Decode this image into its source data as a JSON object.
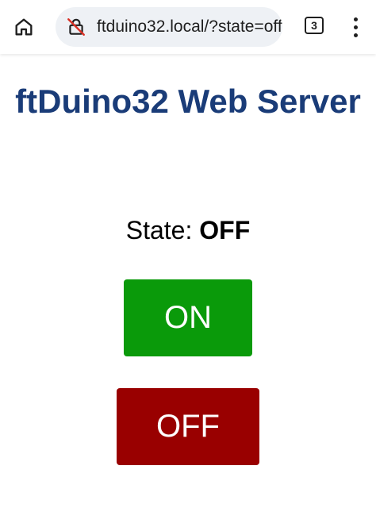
{
  "browser": {
    "home_icon": "home-icon",
    "security_icon": "not-secure-lock-icon",
    "url": "ftduino32.local/?state=off",
    "tab_count": "3",
    "menu_icon": "more-vert-icon"
  },
  "page": {
    "title": "ftDuino32 Web Server",
    "state_label": "State:",
    "state_value": "OFF",
    "on_button_label": "ON",
    "off_button_label": "OFF"
  },
  "colors": {
    "title": "#1a3c78",
    "on_button": "#0a9a0a",
    "off_button": "#990000",
    "urlbar_bg": "#eef1f5"
  }
}
